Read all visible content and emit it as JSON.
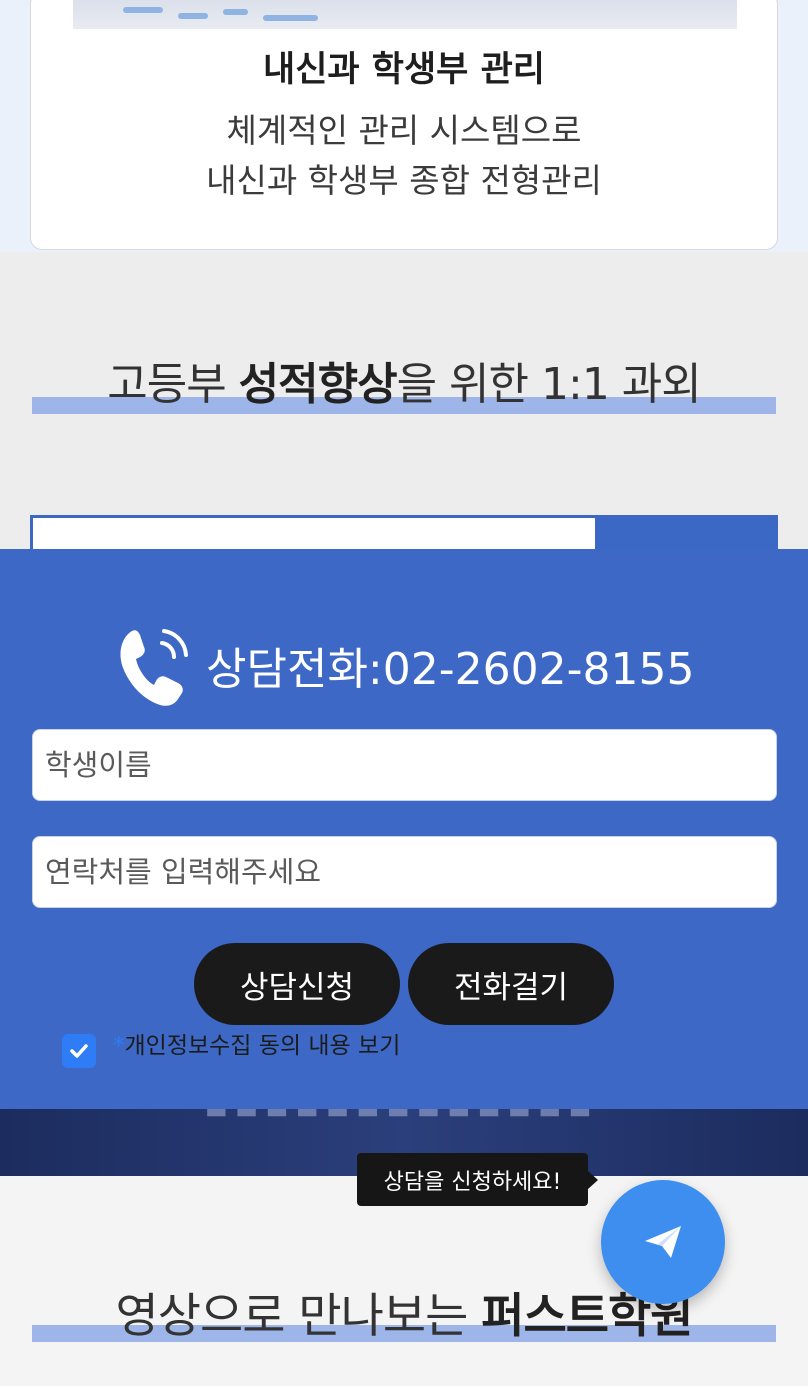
{
  "card": {
    "title": "내신과 학생부 관리",
    "desc_line1": "체계적인 관리 시스템으로",
    "desc_line2": "내신과 학생부 종합 전형관리"
  },
  "section1": {
    "heading_prefix": "고등부 ",
    "heading_bold": "성적향상",
    "heading_suffix": "을 위한 1:1 과외"
  },
  "modal": {
    "phone_label": "상담전화:02-2602-8155",
    "name_placeholder": "학생이름",
    "phone_placeholder": "연락처를 입력해주세요",
    "submit_label": "상담신청",
    "call_label": "전화걸기",
    "consent_star": "*",
    "consent_label": "개인정보수집 동의 내용 보기",
    "consent_checked": true
  },
  "tooltip": {
    "text": "상담을 신청하세요!"
  },
  "fab": {
    "icon": "paper-plane-icon",
    "color": "#3e8ef0"
  },
  "section2": {
    "heading_prefix": "영상으로 만나보는 ",
    "heading_bold": "퍼스트학원"
  },
  "colors": {
    "modal_bg": "#3d68c6",
    "button_bg": "#1a1a1a",
    "underline": "#9db5e8",
    "checkbox": "#2e7cf6"
  }
}
